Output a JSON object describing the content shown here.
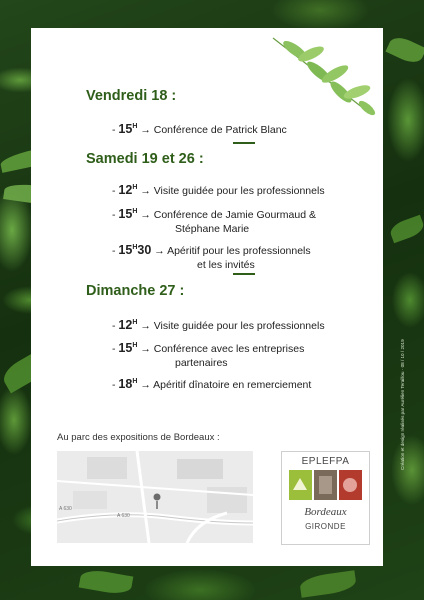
{
  "schedule": [
    {
      "day": "Vendredi 18 :",
      "events": [
        {
          "hour": "15",
          "sup": "H",
          "text": "Conférence de Patrick Blanc",
          "cont": ""
        }
      ]
    },
    {
      "day": "Samedi 19 et 26 :",
      "events": [
        {
          "hour": "12",
          "sup": "H",
          "text": "Visite guidée pour les professionnels",
          "cont": ""
        },
        {
          "hour": "15",
          "sup": "H",
          "text": "Conférence de Jamie Gourmaud &",
          "cont": "Stéphane Marie"
        },
        {
          "hour": "15",
          "sup": "H",
          "hour_suffix": "30",
          "text": "Apéritif pour les professionnels",
          "cont": "et les invités"
        }
      ]
    },
    {
      "day": "Dimanche 27 :",
      "events": [
        {
          "hour": "12",
          "sup": "H",
          "text": "Visite guidée pour les professionnels",
          "cont": ""
        },
        {
          "hour": "15",
          "sup": "H",
          "text": "Conférence avec les entreprises",
          "cont": "partenaires"
        },
        {
          "hour": "18",
          "sup": "H",
          "text": "Apéritif dînatoire en remerciement",
          "cont": ""
        }
      ]
    }
  ],
  "marker": "-",
  "arrow": "→",
  "caption": "Au parc des expositions de Bordeaux :",
  "map": {
    "road_labels": [
      "A 630",
      "A 630"
    ]
  },
  "logo": {
    "top": "EPLEFPA",
    "city": "Bordeaux",
    "region": "GIRONDE"
  },
  "credit": "Création et design réalisés par Aurélien Teraillou · 08 / 10 / 2019",
  "colors": {
    "accent": "#2f5e1a",
    "leaf": "#5f9c3a",
    "card": "#ffffff"
  }
}
